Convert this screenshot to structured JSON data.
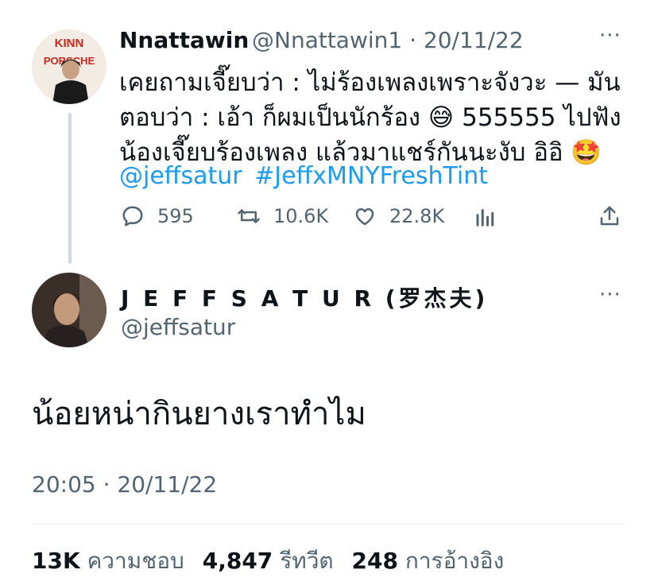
{
  "parent_tweet": {
    "display_name": "Nnattawin",
    "meta": "@Nnattawin1 · 20/11/22",
    "avatar_poster_text": "KINN PORSCHE",
    "more": "···",
    "text": "เคยถามเจี๊ยบว่า : ไม่ร้องเพลงเพราะจังวะ — มัน\nตอบว่า : เอ้า ก็ผมเป็นนักร้อง 😅 555555 ไปฟัง\nน้องเจี๊ยบร้องเพลง แล้วมาแชร์กันนะงับ อิอิ 🤩",
    "mention": "@jeffsatur",
    "hashtag": "#JeffxMNYFreshTint",
    "actions": {
      "replies": "595",
      "retweets": "10.6K",
      "likes": "22.8K"
    }
  },
  "reply_tweet": {
    "display_name": "J E F F S A T U R (罗杰夫)",
    "handle": "@jeffsatur",
    "more": "···",
    "text": "น้อยหน่ากินยางเราทำไม",
    "timestamp": "20:05 · 20/11/22"
  },
  "stats": {
    "likes_count": "13K",
    "likes_label": "ความชอบ",
    "retweets_count": "4,847",
    "retweets_label": "รีทวีต",
    "quotes_count": "248",
    "quotes_label": "การอ้างอิง"
  },
  "colors": {
    "link": "#1d9bf0",
    "muted": "#536471",
    "text": "#0f1419"
  }
}
